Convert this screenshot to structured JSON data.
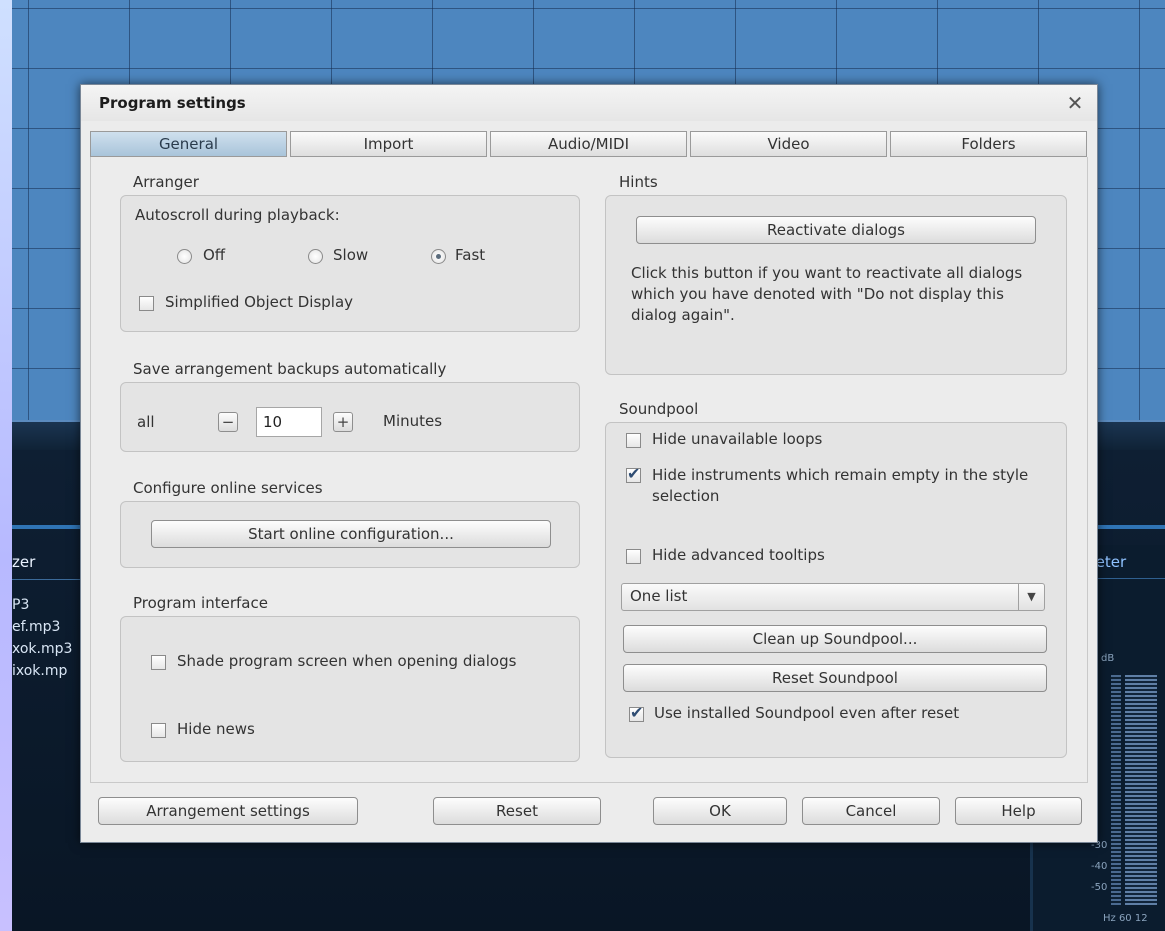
{
  "background": {
    "files_header": "zer",
    "files": [
      "P3",
      "ef.mp3",
      "xok.mp3",
      "ixok.mp"
    ],
    "meter_header": "meter",
    "meter_db": "dB",
    "meter_ticks": [
      "-30",
      "-40",
      "-50"
    ],
    "meter_hz": "Hz 60  12"
  },
  "dialog": {
    "title": "Program settings",
    "close_glyph": "✕",
    "tabs": [
      "General",
      "Import",
      "Audio/MIDI",
      "Video",
      "Folders"
    ],
    "active_tab": "General",
    "arranger": {
      "title": "Arranger",
      "autoscroll_label": "Autoscroll during playback:",
      "options": [
        {
          "label": "Off",
          "selected": false
        },
        {
          "label": "Slow",
          "selected": false
        },
        {
          "label": "Fast",
          "selected": true
        }
      ],
      "simplified_label": "Simplified Object Display",
      "simplified_checked": false
    },
    "backup": {
      "title": "Save arrangement backups automatically",
      "prefix": "all",
      "minus": "−",
      "value": "10",
      "plus": "+",
      "suffix": "Minutes"
    },
    "online": {
      "title": "Configure online services",
      "button": "Start online configuration..."
    },
    "interface": {
      "title": "Program interface",
      "shade_label": "Shade program screen when opening dialogs",
      "shade_checked": false,
      "news_label": "Hide news",
      "news_checked": false
    },
    "hints": {
      "title": "Hints",
      "button": "Reactivate dialogs",
      "text": "Click this button if you want to reactivate all dialogs which you have denoted with \"Do not display this dialog again\"."
    },
    "soundpool": {
      "title": "Soundpool",
      "hide_unavailable": "Hide unavailable loops",
      "hide_unavailable_checked": false,
      "hide_instruments": "Hide instruments which remain empty in the style selection",
      "hide_instruments_checked": true,
      "hide_tooltips": "Hide advanced tooltips",
      "hide_tooltips_checked": false,
      "list_value": "One list",
      "list_arrow": "▼",
      "cleanup_button": "Clean up Soundpool...",
      "reset_button": "Reset Soundpool",
      "use_installed": "Use installed Soundpool even after reset",
      "use_installed_checked": true
    },
    "footer": {
      "arrangement_settings": "Arrangement settings",
      "reset": "Reset",
      "ok": "OK",
      "cancel": "Cancel",
      "help": "Help"
    }
  }
}
